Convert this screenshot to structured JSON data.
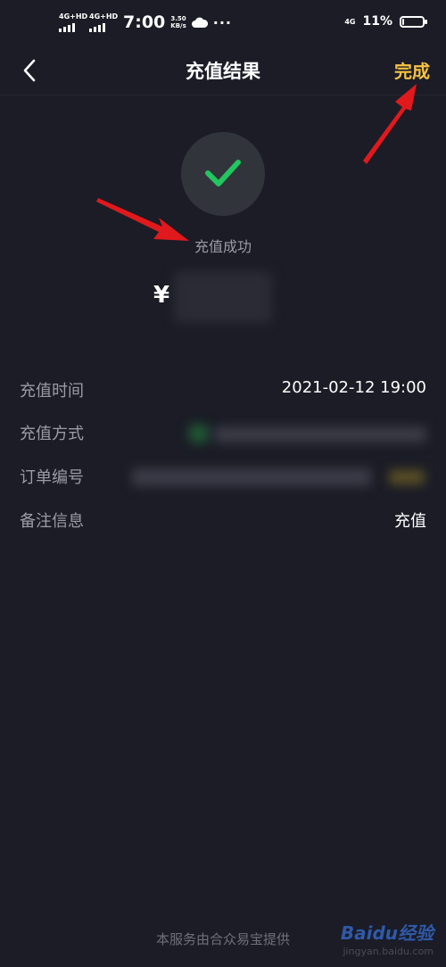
{
  "status_bar": {
    "net1": "4G+HD",
    "net2": "4G+HD",
    "time": "7:00",
    "speed_value": "3.50",
    "speed_unit": "KB/s",
    "more": "···",
    "net3": "4G",
    "battery": "11%",
    "battery_level": 0.11
  },
  "nav": {
    "title": "充值结果",
    "done_label": "完成"
  },
  "result": {
    "text": "充值成功",
    "currency": "¥"
  },
  "details": [
    {
      "label": "充值时间",
      "value": "2021-02-12 19:00"
    },
    {
      "label": "充值方式",
      "value": ""
    },
    {
      "label": "订单编号",
      "value": ""
    },
    {
      "label": "备注信息",
      "value": "充值"
    }
  ],
  "footer": {
    "text": "本服务由合众易宝提供"
  },
  "watermark": {
    "brand": "Baidu经验",
    "site": "jingyan.baidu.com"
  },
  "colors": {
    "background": "#1b1c26",
    "accent": "#f5c242",
    "success": "#22c55e",
    "annotation_arrow": "#e0191d"
  }
}
